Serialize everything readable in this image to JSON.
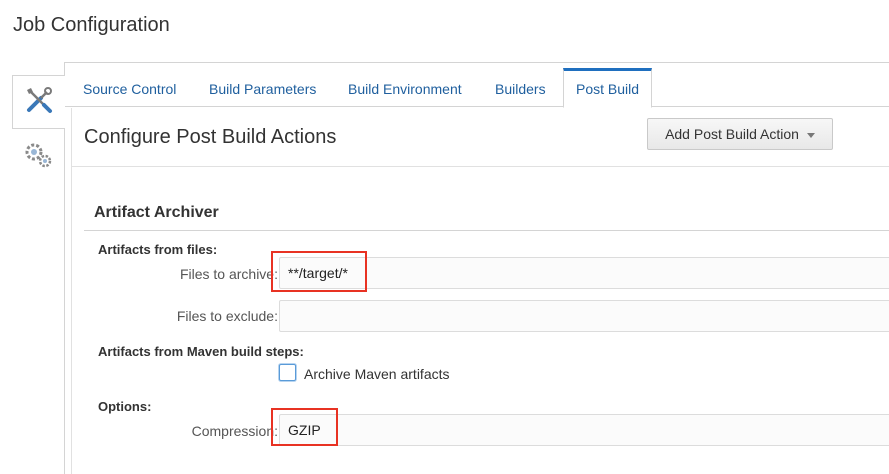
{
  "page": {
    "title": "Job Configuration"
  },
  "left_rail": {
    "tabs": [
      {
        "icon": "tools-icon"
      },
      {
        "icon": "gears-icon"
      }
    ]
  },
  "tabs": [
    {
      "label": "Source Control"
    },
    {
      "label": "Build Parameters"
    },
    {
      "label": "Build Environment"
    },
    {
      "label": "Builders"
    },
    {
      "label": "Post Build",
      "active": true
    }
  ],
  "main": {
    "section_title": "Configure Post Build Actions",
    "add_button_label": "Add Post Build Action",
    "artifact_archiver": {
      "title": "Artifact Archiver",
      "files_group_label": "Artifacts from files:",
      "files_to_archive_label": "Files to archive:",
      "files_to_archive_value": "**/target/*",
      "files_to_exclude_label": "Files to exclude:",
      "files_to_exclude_value": "",
      "maven_group_label": "Artifacts from Maven build steps:",
      "archive_maven_label": "Archive Maven artifacts",
      "archive_maven_checked": false,
      "options_label": "Options:",
      "compression_label": "Compression:",
      "compression_value": "GZIP"
    }
  },
  "colors": {
    "tab_link": "#1f5f9e",
    "active_tab_accent": "#1f6fbf",
    "highlight": "#e83223"
  }
}
